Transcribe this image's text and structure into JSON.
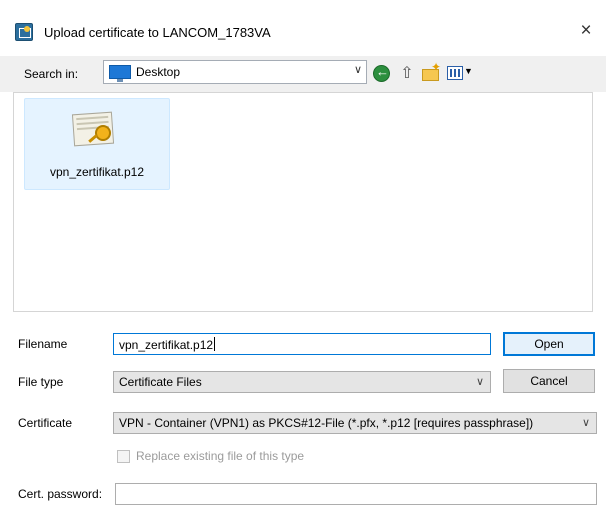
{
  "window": {
    "title": "Upload certificate to LANCOM_1783VA",
    "close_glyph": "×",
    "app_icon": "certificate-upload-icon"
  },
  "toolbar": {
    "search_label": "Search in:",
    "location": "Desktop",
    "location_icon": "desktop-icon",
    "chevron": "∨",
    "icons": [
      "back-icon",
      "up-folder-icon",
      "new-folder-icon",
      "view-menu-icon"
    ]
  },
  "files": [
    {
      "name": "vpn_zertifikat.p12",
      "icon": "certificate-file-icon"
    }
  ],
  "form": {
    "filename_label": "Filename",
    "filename_value": "vpn_zertifikat.p12",
    "filetype_label": "File type",
    "filetype_value": "Certificate Files",
    "certificate_label": "Certificate",
    "certificate_value": "VPN - Container (VPN1) as PKCS#12-File (*.pfx, *.p12 [requires passphrase])",
    "replace_label": "Replace existing file of this type",
    "password_label": "Cert. password:",
    "password_value": ""
  },
  "buttons": {
    "open": "Open",
    "cancel": "Cancel"
  },
  "colors": {
    "selection_bg": "#e5f3ff",
    "default_button_border": "#0078d7",
    "dialog_bg": "#f0f0f0"
  }
}
